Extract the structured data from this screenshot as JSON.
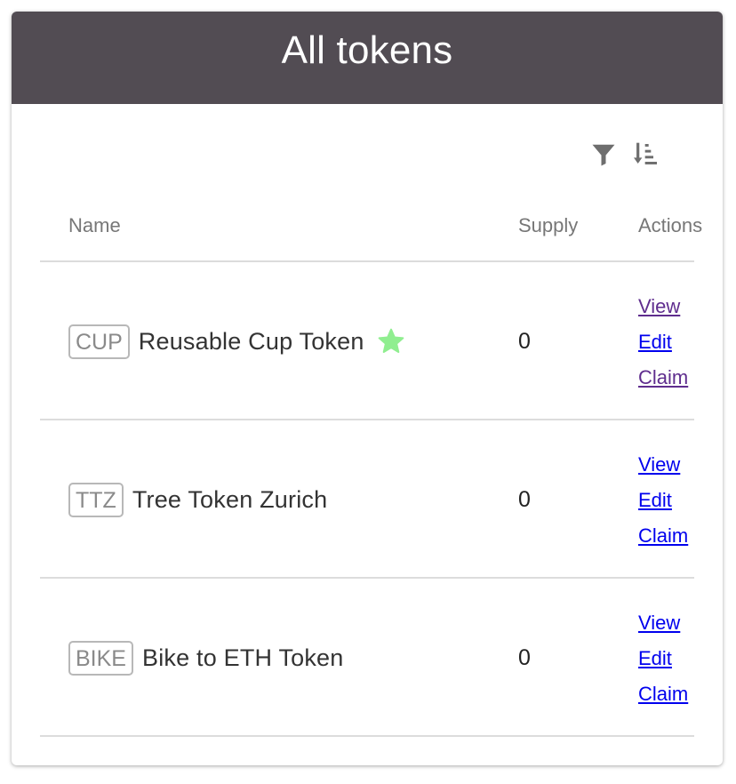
{
  "header": {
    "title": "All tokens"
  },
  "toolbar": {
    "filter_icon": "filter-icon",
    "sort_icon": "sort-icon"
  },
  "table": {
    "columns": {
      "name": "Name",
      "supply": "Supply",
      "actions": "Actions"
    },
    "rows": [
      {
        "symbol": "CUP",
        "name": "Reusable Cup Token",
        "starred": true,
        "supply": "0",
        "actions": {
          "view": "View",
          "edit": "Edit",
          "claim": "Claim"
        }
      },
      {
        "symbol": "TTZ",
        "name": "Tree Token Zurich",
        "starred": false,
        "supply": "0",
        "actions": {
          "view": "View",
          "edit": "Edit",
          "claim": "Claim"
        }
      },
      {
        "symbol": "BIKE",
        "name": "Bike to ETH Token",
        "starred": false,
        "supply": "0",
        "actions": {
          "view": "View",
          "edit": "Edit",
          "claim": "Claim"
        }
      }
    ]
  },
  "colors": {
    "header_bg": "#524c53",
    "star": "#90ee90",
    "link": "#0000ee",
    "visited_link": "#5f2d8e"
  }
}
